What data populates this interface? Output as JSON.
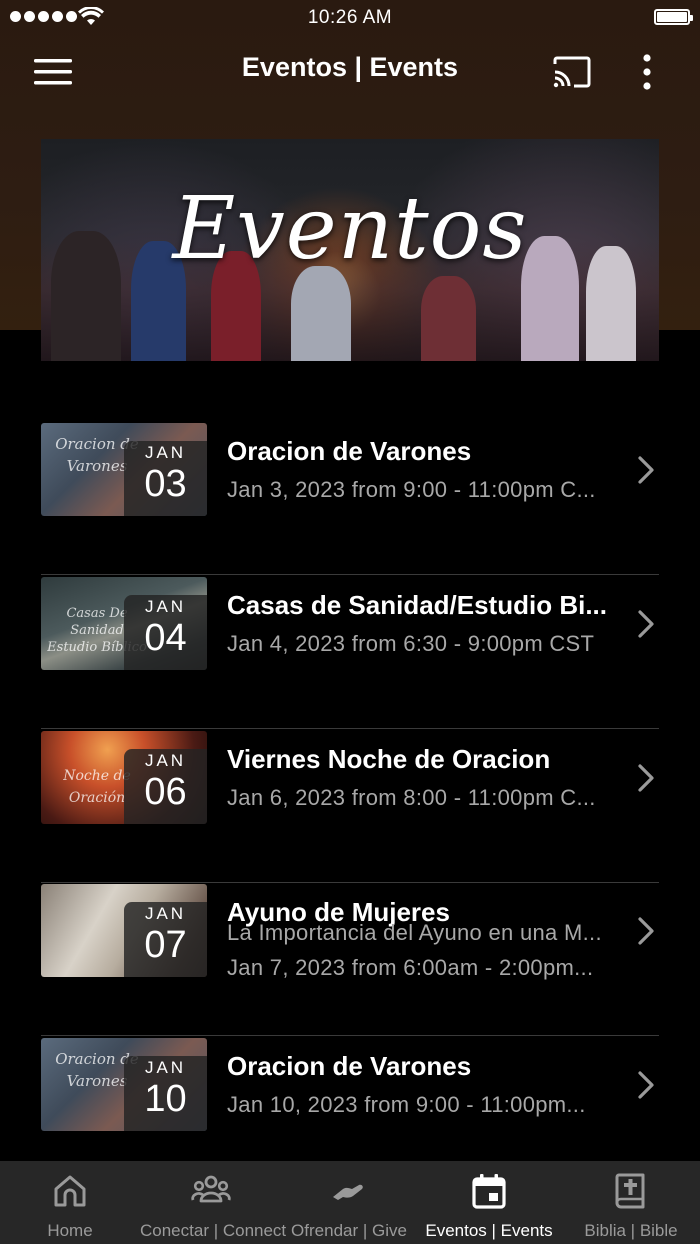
{
  "status": {
    "time": "10:26 AM"
  },
  "header": {
    "title": "Eventos | Events"
  },
  "banner": {
    "text": "Eventos"
  },
  "events": [
    {
      "month": "JAN",
      "day": "03",
      "title": "Oracion de Varones",
      "lines": [
        "Jan 3, 2023 from 9:00 - 11:00pm C..."
      ],
      "thumb_text": "Oracion de Varones"
    },
    {
      "month": "JAN",
      "day": "04",
      "title": "Casas de Sanidad/Estudio Bi...",
      "lines": [
        "Jan 4, 2023 from 6:30 - 9:00pm CST"
      ],
      "thumb_text": "Casas De Sanidad Estudio Bíblico"
    },
    {
      "month": "JAN",
      "day": "06",
      "title": "Viernes Noche de Oracion",
      "lines": [
        "Jan 6, 2023 from 8:00 - 11:00pm C..."
      ],
      "thumb_text": "Noche de Oración"
    },
    {
      "month": "JAN",
      "day": "07",
      "title": "Ayuno de Mujeres",
      "lines": [
        "La Importancia del Ayuno en una M...",
        "Jan 7, 2023 from 6:00am - 2:00pm..."
      ],
      "thumb_text": ""
    },
    {
      "month": "JAN",
      "day": "10",
      "title": "Oracion de Varones",
      "lines": [
        "Jan 10, 2023 from 9:00 - 11:00pm..."
      ],
      "thumb_text": "Oracion de Varones"
    }
  ],
  "tabs": [
    {
      "label": "Home",
      "icon": "home-icon",
      "active": false
    },
    {
      "label": "Conectar | Connect",
      "icon": "group-icon",
      "active": false
    },
    {
      "label": "Ofrendar | Give",
      "icon": "give-hand-icon",
      "active": false
    },
    {
      "label": "Eventos | Events",
      "icon": "calendar-icon",
      "active": true
    },
    {
      "label": "Biblia | Bible",
      "icon": "bible-icon",
      "active": false
    }
  ],
  "colors": {
    "header_bg": "#2e1d12",
    "tabbar_bg": "#272727",
    "subtitle": "#a8a8a8",
    "inactive_tab": "#9a9a9a"
  }
}
